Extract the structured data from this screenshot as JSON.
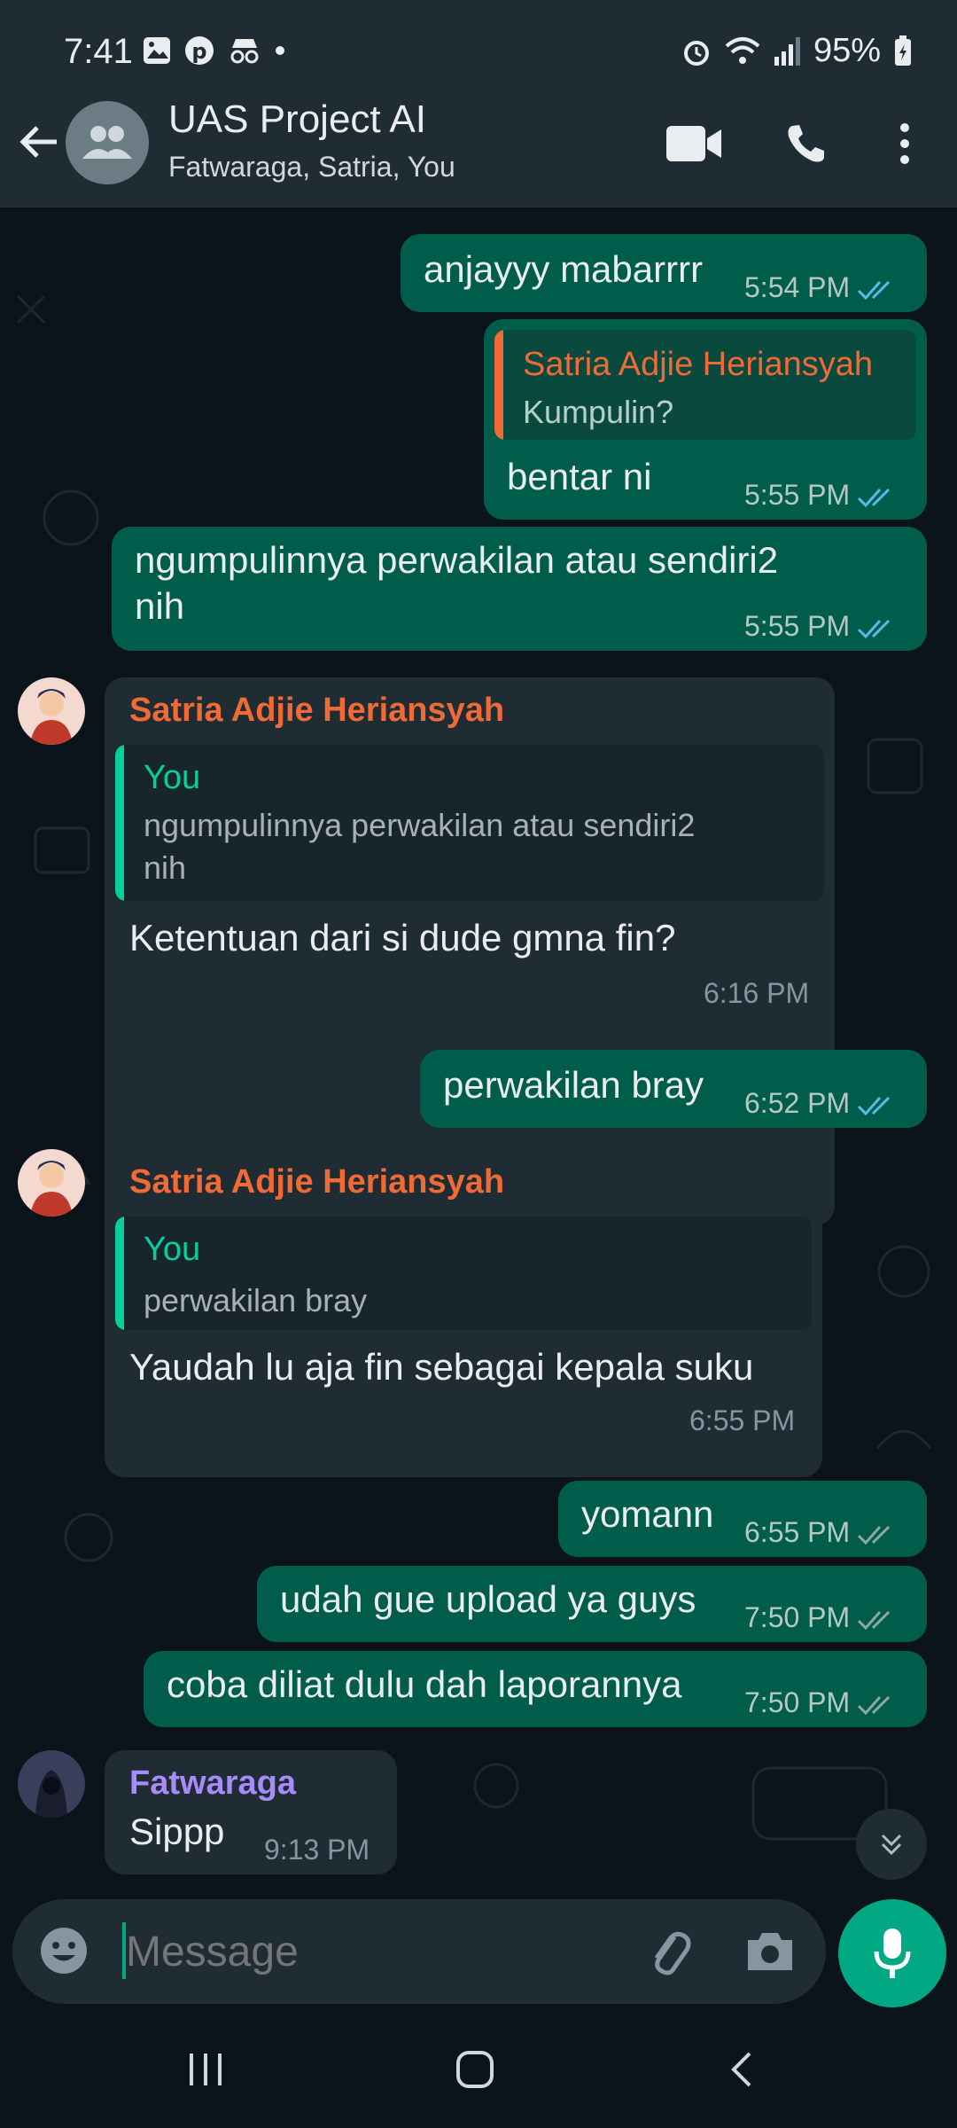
{
  "status_bar": {
    "time": "7:41",
    "battery": "95%"
  },
  "header": {
    "title": "UAS Project AI",
    "subtitle": "Fatwaraga, Satria, You"
  },
  "messages": [
    {
      "dir": "out",
      "text": "anjayyy mabarrrr",
      "time": "5:54 PM",
      "status": "read"
    },
    {
      "dir": "out",
      "quote_name": "Satria Adjie Heriansyah",
      "quote_text": "Kumpulin?",
      "text": "bentar ni",
      "time": "5:55 PM",
      "status": "read"
    },
    {
      "dir": "out",
      "text_line1": "ngumpulinnya perwakilan atau sendiri2",
      "text_line2": "nih",
      "time": "5:55 PM",
      "status": "read"
    },
    {
      "dir": "in",
      "sender": "Satria Adjie Heriansyah",
      "quote_name": "You",
      "quote_line1": "ngumpulinnya perwakilan atau sendiri2",
      "quote_line2": "nih",
      "text": "Ketentuan dari si dude gmna fin?",
      "time": "6:16 PM"
    },
    {
      "dir": "out",
      "text": "perwakilan bray",
      "time": "6:52 PM",
      "status": "read"
    },
    {
      "dir": "in",
      "sender": "Satria Adjie Heriansyah",
      "quote_name": "You",
      "quote_text": "perwakilan bray",
      "text": "Yaudah lu aja fin sebagai kepala suku",
      "time": "6:55 PM"
    },
    {
      "dir": "out",
      "text": "yomann",
      "time": "6:55 PM",
      "status": "delivered"
    },
    {
      "dir": "out",
      "text": "udah gue upload ya guys",
      "time": "7:50 PM",
      "status": "delivered"
    },
    {
      "dir": "out",
      "text": "coba diliat dulu dah laporannya",
      "time": "7:50 PM",
      "status": "delivered"
    },
    {
      "dir": "in",
      "sender": "Fatwaraga",
      "text": "Sippp",
      "time": "9:13 PM"
    }
  ],
  "input": {
    "placeholder": "Message"
  },
  "colors": {
    "accent": "#00a884",
    "outgoing_bubble": "#005c4b",
    "incoming_bubble": "#1f2c34",
    "satria_name": "#f06a35",
    "fatwaraga_name": "#a78bfa",
    "you_quote": "#06cf9c",
    "read_tick": "#53bdeb"
  },
  "icons": [
    "back-arrow-icon",
    "group-icon",
    "video-call-icon",
    "phone-icon",
    "more-options-icon",
    "emoji-icon",
    "attach-icon",
    "camera-icon",
    "mic-icon",
    "scroll-down-icon",
    "recents-nav-icon",
    "home-nav-icon",
    "back-nav-icon"
  ]
}
